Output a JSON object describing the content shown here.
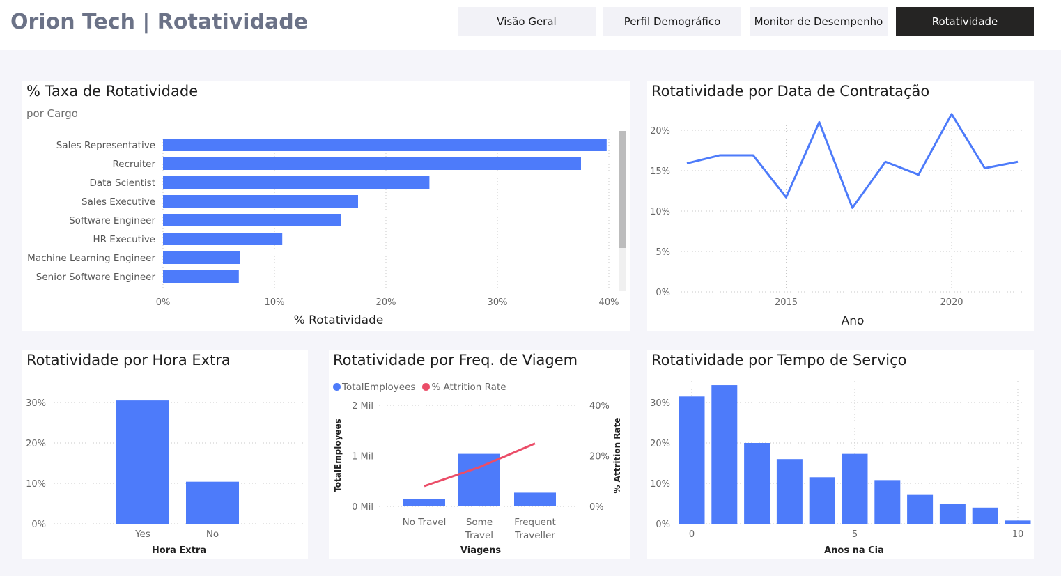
{
  "header": {
    "title": "Orion Tech | Rotatividade",
    "nav": [
      {
        "label": "Visão Geral",
        "active": false
      },
      {
        "label": "Perfil Demográfico",
        "active": false
      },
      {
        "label": "Monitor de Desempenho",
        "active": false
      },
      {
        "label": "Rotatividade",
        "active": true
      }
    ]
  },
  "colors": {
    "bar": "#4d7bfa",
    "line_red": "#eb4d68",
    "nav_active": "#252423",
    "title_gray": "#6b7287"
  },
  "charts": {
    "cargo": {
      "title": "% Taxa de Rotatividade",
      "subtitle": "por Cargo",
      "chart_data": {
        "type": "bar",
        "orientation": "horizontal",
        "categories": [
          "Sales Representative",
          "Recruiter",
          "Data Scientist",
          "Sales Executive",
          "Software Engineer",
          "HR Executive",
          "Machine Learning Engineer",
          "Senior Software Engineer"
        ],
        "values": [
          39.8,
          37.5,
          23.9,
          17.5,
          16.0,
          10.7,
          6.9,
          6.8
        ],
        "xlabel": "% Rotatividade",
        "xlim": [
          0,
          40
        ],
        "ticks": [
          "0%",
          "10%",
          "20%",
          "30%",
          "40%"
        ],
        "grid": true
      }
    },
    "contratacao": {
      "title": "Rotatividade por Data de Contratação",
      "chart_data": {
        "type": "line",
        "x": [
          2012,
          2013,
          2014,
          2015,
          2016,
          2017,
          2018,
          2019,
          2020,
          2021,
          2022
        ],
        "values": [
          15.9,
          16.9,
          16.9,
          11.7,
          21.0,
          10.4,
          16.1,
          14.5,
          22.0,
          15.3,
          16.1
        ],
        "xlabel": "Ano",
        "ylim": [
          0,
          20
        ],
        "yticks": [
          "0%",
          "5%",
          "10%",
          "15%",
          "20%"
        ],
        "xticks": [
          "2015",
          "2020"
        ],
        "grid": true
      }
    },
    "hora_extra": {
      "title": "Rotatividade por Hora Extra",
      "chart_data": {
        "type": "bar",
        "categories": [
          "Yes",
          "No"
        ],
        "values": [
          30.5,
          10.4
        ],
        "xlabel": "Hora Extra",
        "ylim": [
          0,
          30
        ],
        "yticks": [
          "0%",
          "10%",
          "20%",
          "30%"
        ],
        "grid": true
      }
    },
    "viagem": {
      "title": "Rotatividade por Freq. de Viagem",
      "legend": [
        "TotalEmployees",
        "% Attrition Rate"
      ],
      "chart_data": {
        "type": "bar",
        "categories": [
          "No Travel",
          "Some Travel",
          "Frequent Traveller"
        ],
        "category_lines": [
          [
            "No Travel"
          ],
          [
            "Some",
            "Travel"
          ],
          [
            "Frequent",
            "Traveller"
          ]
        ],
        "series": [
          {
            "name": "TotalEmployees",
            "type": "bar",
            "axis": "left",
            "values": [
              150,
              1040,
              270
            ]
          },
          {
            "name": "% Attrition Rate",
            "type": "line",
            "axis": "right",
            "values": [
              8.0,
              15.5,
              24.9
            ]
          }
        ],
        "xlabel": "Viagens",
        "ylabel_left": "TotalEmployees",
        "ylabel_right": "% Attrition Rate",
        "ylim_left": [
          0,
          2000
        ],
        "ylim_right": [
          0,
          40
        ],
        "yticks_left": [
          "0 Mil",
          "1 Mil",
          "2 Mil"
        ],
        "yticks_right": [
          "0%",
          "20%",
          "40%"
        ],
        "grid": true
      }
    },
    "tempo_servico": {
      "title": "Rotatividade por Tempo de Serviço",
      "chart_data": {
        "type": "bar",
        "x": [
          0,
          1,
          2,
          3,
          4,
          5,
          6,
          7,
          8,
          9,
          10
        ],
        "values": [
          31.5,
          34.3,
          20.0,
          16.0,
          11.5,
          17.3,
          10.8,
          7.3,
          4.9,
          4.0,
          0.8
        ],
        "xlabel": "Anos na Cia",
        "ylim": [
          0,
          30
        ],
        "yticks": [
          "0%",
          "10%",
          "20%",
          "30%"
        ],
        "xticks": [
          "0",
          "5",
          "10"
        ],
        "grid": true
      }
    }
  }
}
